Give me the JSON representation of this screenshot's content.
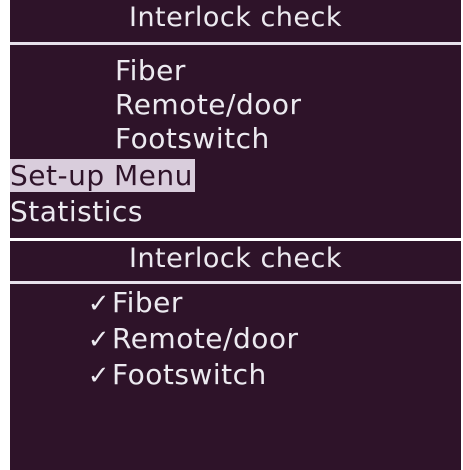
{
  "screen_top": {
    "title": "Interlock check",
    "submenu_items": [
      {
        "label": "Fiber"
      },
      {
        "label": "Remote/door"
      },
      {
        "label": "Footswitch"
      }
    ],
    "menu_items": [
      {
        "label": "Set-up Menu",
        "selected": true
      },
      {
        "label": "Statistics",
        "selected": false
      }
    ]
  },
  "screen_bottom": {
    "title": "Interlock check",
    "checked_items": [
      {
        "label": "Fiber",
        "check_icon": "checkmark-icon",
        "check_glyph": "✓"
      },
      {
        "label": "Remote/door",
        "check_icon": "checkmark-icon",
        "check_glyph": "✓"
      },
      {
        "label": "Footswitch",
        "check_icon": "checkmark-icon",
        "check_glyph": "✓"
      }
    ]
  },
  "colors": {
    "background": "#2e1329",
    "text": "#eceaf0",
    "highlight": "#d9cddc"
  }
}
